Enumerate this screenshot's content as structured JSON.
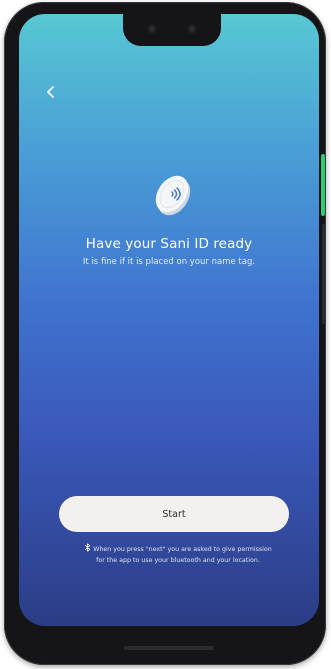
{
  "header": {
    "back_icon": "chevron-left-icon"
  },
  "illustration": {
    "icon": "sani-id-device-icon"
  },
  "main": {
    "title": "Have your Sani ID ready",
    "subtitle": "It is fine if it is placed on your name tag."
  },
  "actions": {
    "start_label": "Start"
  },
  "footer": {
    "bluetooth_icon": "bluetooth-icon",
    "notice_line1": "When you press \"next\" you are asked to give permission",
    "notice_line2": "for the app to use your bluetooth and your location."
  },
  "colors": {
    "gradient_top": "#57c8d3",
    "gradient_mid": "#3f72cf",
    "gradient_bottom": "#2b3d86",
    "button_bg": "#f3f1ee"
  }
}
